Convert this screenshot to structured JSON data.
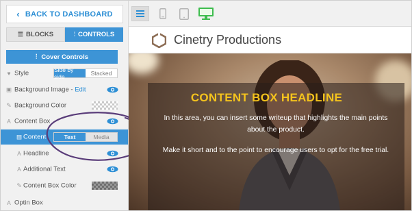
{
  "nav": {
    "back_label": "BACK TO DASHBOARD"
  },
  "tabs": {
    "blocks": "BLOCKS",
    "controls": "CONTROLS"
  },
  "cover_button": "Cover Controls",
  "style_row": {
    "label": "Style",
    "options": [
      "Side by side",
      "Stacked"
    ],
    "selected": "Side by side"
  },
  "rows": {
    "background_image": {
      "label": "Background Image - ",
      "edit": "Edit"
    },
    "background_color": {
      "label": "Background Color"
    },
    "content_box": {
      "label": "Content Box"
    },
    "content": {
      "label": "Content",
      "options": [
        "Text",
        "Media"
      ],
      "selected": "Text"
    },
    "headline": {
      "label": "Headline"
    },
    "additional_text": {
      "label": "Additional Text"
    },
    "content_box_color": {
      "label": "Content Box Color"
    },
    "optin_box": {
      "label": "Optin Box"
    }
  },
  "site": {
    "title": "Cinetry Productions",
    "headline": "CONTENT BOX HEADLINE",
    "body_1": "In this area, you can insert some writeup that highlights the main points about the product.",
    "body_2": "Make it short and to the point to encourage users to opt for the free trial."
  },
  "colors": {
    "accent": "#3d94d6",
    "headline": "#f4c31d",
    "annotation_circle": "#5a3d7a"
  }
}
